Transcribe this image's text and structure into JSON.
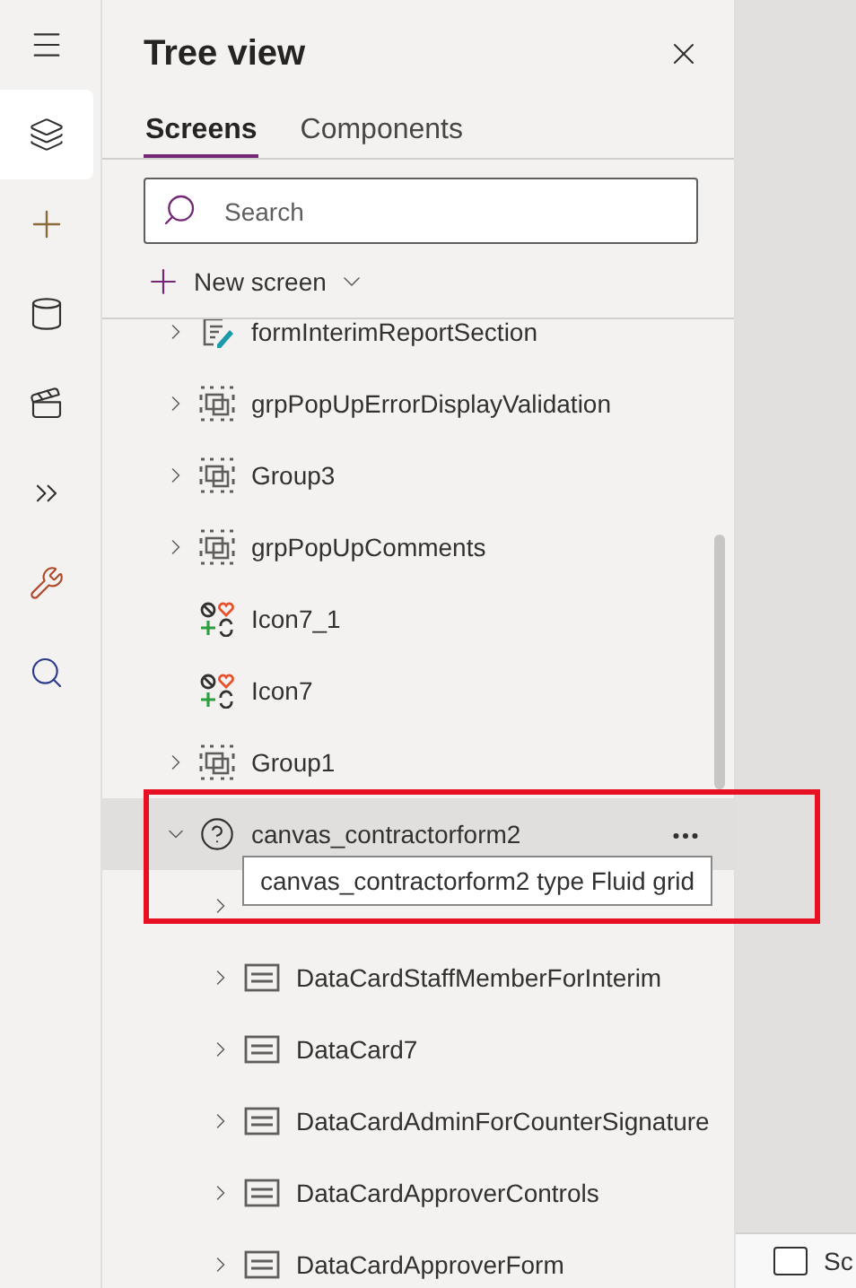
{
  "rail": [
    {
      "kind": "menu",
      "selected": false
    },
    {
      "kind": "layers",
      "selected": true
    },
    {
      "kind": "insert",
      "selected": false
    },
    {
      "kind": "data",
      "selected": false
    },
    {
      "kind": "media",
      "selected": false
    },
    {
      "kind": "automate",
      "selected": false
    },
    {
      "kind": "tools",
      "selected": false
    },
    {
      "kind": "search",
      "selected": false
    }
  ],
  "panel": {
    "title": "Tree view",
    "tabs": [
      {
        "label": "Screens",
        "selected": true
      },
      {
        "label": "Components",
        "selected": false
      }
    ],
    "search": {
      "placeholder": "Search"
    },
    "new_screen": "New screen"
  },
  "tree": {
    "items": [
      {
        "label": "formInterimReportSection",
        "kind": "form",
        "expanded": false,
        "selected": false
      },
      {
        "label": "grpPopUpErrorDisplayValidation",
        "kind": "group",
        "expanded": false,
        "selected": false
      },
      {
        "label": "Group3",
        "kind": "group",
        "expanded": false,
        "selected": false
      },
      {
        "label": "grpPopUpComments",
        "kind": "group",
        "expanded": false,
        "selected": false
      },
      {
        "label": "Icon7_1",
        "kind": "icon",
        "selected": false
      },
      {
        "label": "Icon7",
        "kind": "icon",
        "selected": false
      },
      {
        "label": "Group1",
        "kind": "group",
        "expanded": false,
        "selected": false
      },
      {
        "label": "canvas_contractorform2",
        "kind": "container",
        "expanded": true,
        "selected": true,
        "children": [
          {
            "expanded": false,
            "selected": false
          },
          {
            "label": "DataCardStaffMemberForInterim",
            "kind": "datacard",
            "expanded": false,
            "selected": false
          },
          {
            "label": "DataCard7",
            "kind": "datacard",
            "expanded": false,
            "selected": false
          },
          {
            "label": "DataCardAdminForCounterSignature",
            "kind": "datacard",
            "expanded": false,
            "selected": false
          },
          {
            "label": "DataCardApproverControls",
            "kind": "datacard",
            "expanded": false,
            "selected": false
          },
          {
            "label": "DataCardApproverForm",
            "kind": "datacard",
            "expanded": false,
            "selected": false
          }
        ]
      }
    ]
  },
  "tooltip": "canvas_contractorform2 type Fluid grid",
  "canvas_footer": {
    "checked": false,
    "label": "Sc"
  }
}
